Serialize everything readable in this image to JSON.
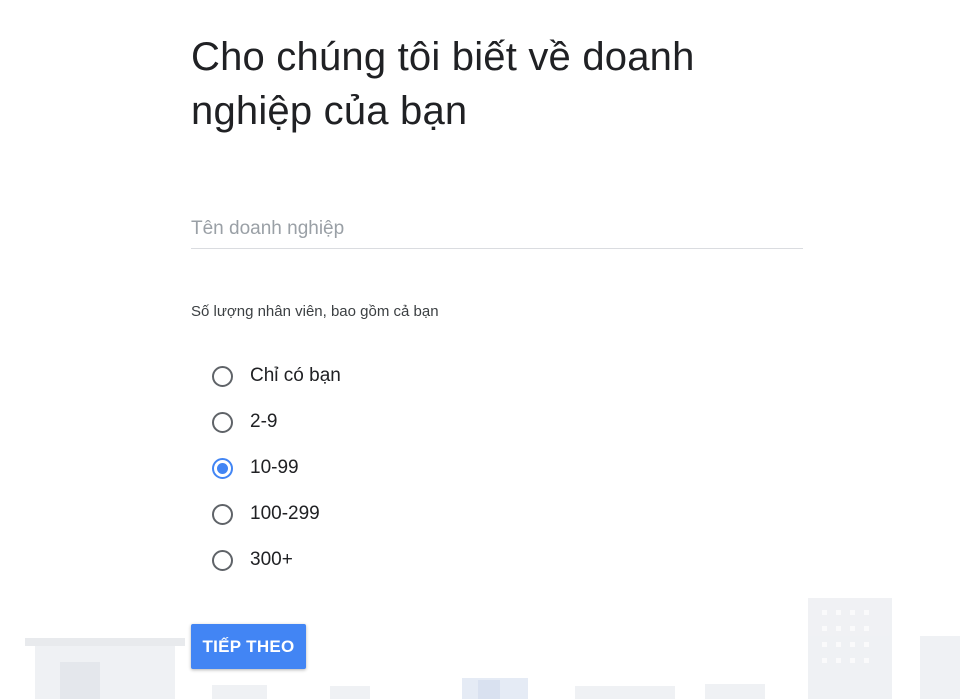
{
  "title": "Cho chúng tôi biết về doanh nghiệp của bạn",
  "business_name": {
    "placeholder": "Tên doanh nghiệp",
    "value": ""
  },
  "employees": {
    "label": "Số lượng nhân viên, bao gồm cả bạn",
    "options": [
      {
        "label": "Chỉ có bạn",
        "selected": false
      },
      {
        "label": "2-9",
        "selected": false
      },
      {
        "label": "10-99",
        "selected": true
      },
      {
        "label": "100-299",
        "selected": false
      },
      {
        "label": "300+",
        "selected": false
      }
    ]
  },
  "next_button_label": "TIẾP THEO",
  "colors": {
    "accent": "#4285f4",
    "title_text": "#202124",
    "placeholder": "#9aa0a6",
    "radio_unselected": "#5f6368"
  }
}
